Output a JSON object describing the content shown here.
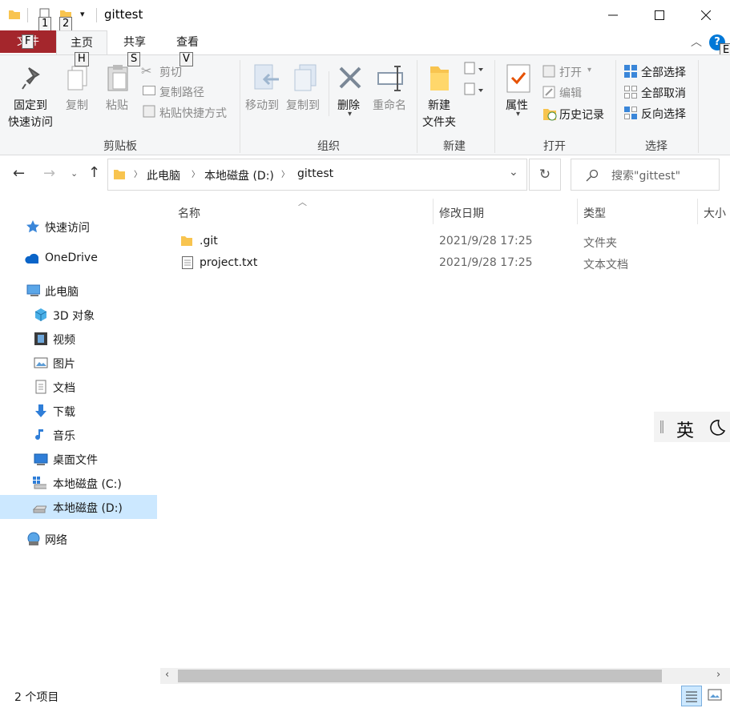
{
  "window": {
    "title": "gittest",
    "keytips": {
      "qa1": "1",
      "qa2": "2",
      "file": "F",
      "home": "H",
      "share": "S",
      "view": "V",
      "help": "E"
    }
  },
  "tabs": {
    "file": "文件",
    "home": "主页",
    "share": "共享",
    "view": "查看"
  },
  "ribbon": {
    "clipboard": {
      "pin_l1": "固定到",
      "pin_l2": "快速访问",
      "copy": "复制",
      "paste": "粘贴",
      "cut": "剪切",
      "copy_path": "复制路径",
      "paste_shortcut": "粘贴快捷方式",
      "group": "剪贴板"
    },
    "organize": {
      "move_to": "移动到",
      "copy_to": "复制到",
      "delete": "删除",
      "rename": "重命名",
      "group": "组织"
    },
    "new": {
      "l1": "新建",
      "l2": "文件夹",
      "group": "新建"
    },
    "open": {
      "properties": "属性",
      "open": "打开",
      "edit": "编辑",
      "history": "历史记录",
      "group": "打开"
    },
    "select": {
      "all": "全部选择",
      "none": "全部取消",
      "invert": "反向选择",
      "group": "选择"
    }
  },
  "address": {
    "crumbs": [
      "此电脑",
      "本地磁盘 (D:)",
      "gittest"
    ],
    "search_placeholder": "搜索\"gittest\""
  },
  "sidebar": {
    "items": [
      "快速访问",
      "OneDrive",
      "此电脑",
      "3D 对象",
      "视频",
      "图片",
      "文档",
      "下载",
      "音乐",
      "桌面文件",
      "本地磁盘 (C:)",
      "本地磁盘 (D:)",
      "网络"
    ],
    "selected": "本地磁盘 (D:)"
  },
  "columns": {
    "name": "名称",
    "date": "修改日期",
    "type": "类型",
    "size": "大小"
  },
  "files": [
    {
      "name": ".git",
      "date": "2021/9/28 17:25",
      "type": "文件夹",
      "icon": "folder-icon"
    },
    {
      "name": "project.txt",
      "date": "2021/9/28 17:25",
      "type": "文本文档",
      "icon": "text-file-icon"
    }
  ],
  "ime": {
    "mode": "英"
  },
  "status": {
    "count": "2 个项目"
  },
  "colors": {
    "file_tab": "#a4262c",
    "selected": "#cce8ff",
    "folder": "#f8c44f",
    "accent": "#0078d7"
  }
}
